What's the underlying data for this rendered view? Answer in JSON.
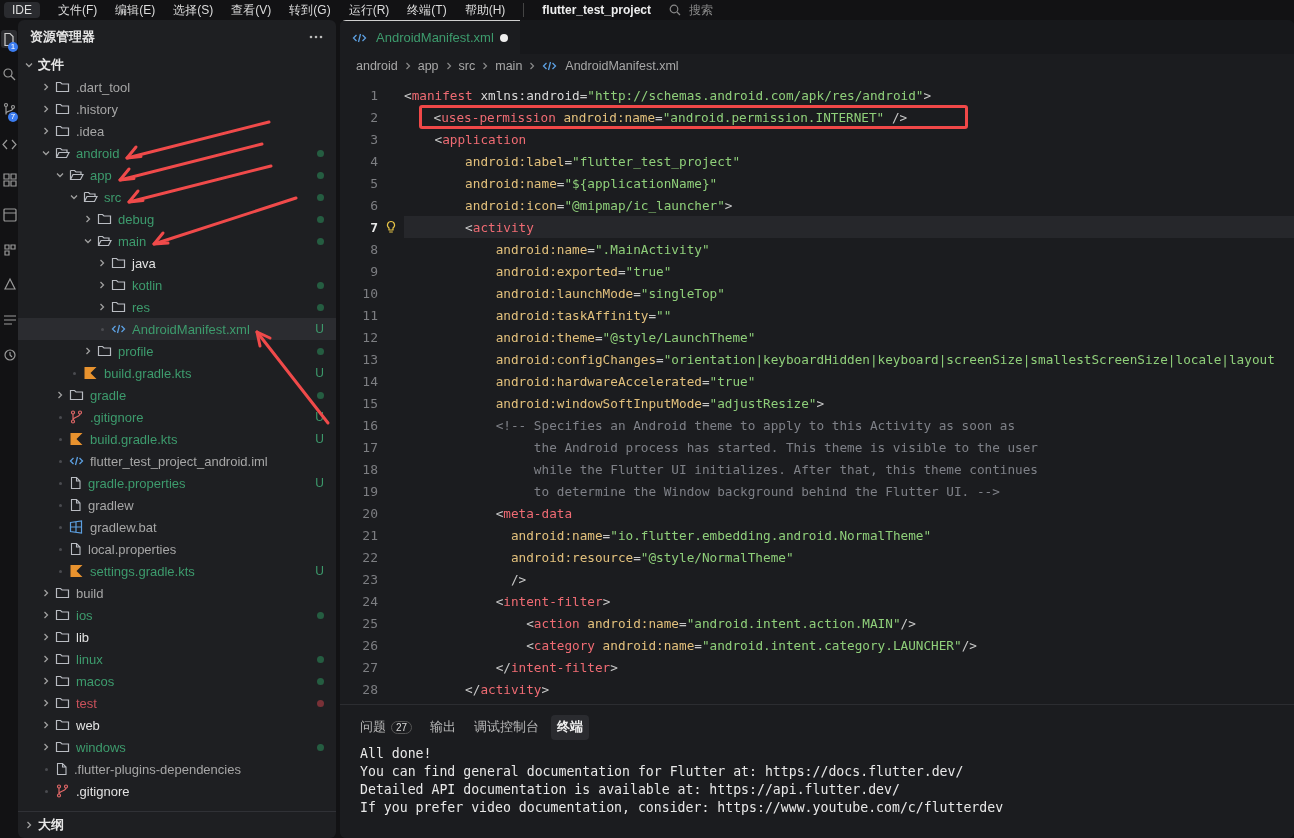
{
  "menu_bar": {
    "logo": "IDE",
    "menus": [
      "文件(F)",
      "编辑(E)",
      "选择(S)",
      "查看(V)",
      "转到(G)",
      "运行(R)",
      "终端(T)",
      "帮助(H)"
    ],
    "project_title": "flutter_test_project",
    "search": {
      "placeholder": "搜索"
    }
  },
  "activity_bar": [
    {
      "selected": true,
      "badge": "1"
    },
    {
      "selected": false
    },
    {
      "selected": false,
      "badge": "7"
    },
    {
      "selected": false
    },
    {
      "selected": false
    },
    {
      "selected": false
    },
    {
      "selected": false
    },
    {
      "selected": false
    },
    {
      "selected": false
    },
    {
      "selected": false
    }
  ],
  "sidebar": {
    "title": "资源管理器",
    "sections": [
      {
        "title": "文件",
        "expanded": true,
        "items": [
          {
            "label": ".dart_tool",
            "kind": "folder",
            "expanded": false,
            "selected": false,
            "color": "#a6a6a6",
            "dot": false
          },
          {
            "label": ".history",
            "kind": "folder",
            "expanded": false,
            "selected": false,
            "color": "#a6a6a6",
            "dot": false
          },
          {
            "label": ".idea",
            "kind": "folder",
            "expanded": false,
            "selected": false,
            "color": "#a6a6a6",
            "dot": false
          },
          {
            "label": "android",
            "kind": "folder",
            "expanded": true,
            "selected": false,
            "color": "#3d9b6d",
            "dot": true,
            "arrow": {
              "kind": "upper-right"
            },
            "children": [
              {
                "label": "app",
                "kind": "folder",
                "expanded": true,
                "selected": false,
                "color": "#3d9b6d",
                "dot": true,
                "arrow": {
                  "kind": "upper-right"
                },
                "children": [
                  {
                    "label": "src",
                    "kind": "folder",
                    "expanded": true,
                    "selected": false,
                    "color": "#3d9b6d",
                    "dot": true,
                    "arrow": {
                      "kind": "upper-right"
                    },
                    "children": [
                      {
                        "label": "debug",
                        "kind": "folder",
                        "expanded": false,
                        "selected": false,
                        "color": "#3d9b6d",
                        "dot": true
                      },
                      {
                        "label": "main",
                        "kind": "folder",
                        "expanded": true,
                        "selected": false,
                        "color": "#3d9b6d",
                        "dot": true,
                        "arrow": {
                          "kind": "upper-right-long"
                        },
                        "children": [
                          {
                            "label": "java",
                            "kind": "folder",
                            "expanded": false,
                            "selected": false,
                            "color": "#e2e2e2",
                            "dot": false
                          },
                          {
                            "label": "kotlin",
                            "kind": "folder",
                            "expanded": false,
                            "selected": false,
                            "color": "#3d9b6d",
                            "dot": true
                          },
                          {
                            "label": "res",
                            "kind": "folder",
                            "expanded": false,
                            "selected": false,
                            "color": "#3d9b6d",
                            "dot": true
                          },
                          {
                            "label": "AndroidManifest.xml",
                            "kind": "xml",
                            "selected": true,
                            "color": "#3d9b6d",
                            "dot": false,
                            "badge": "U",
                            "arrow": {
                              "kind": "lower-right"
                            }
                          }
                        ]
                      },
                      {
                        "label": "profile",
                        "kind": "folder",
                        "expanded": false,
                        "selected": false,
                        "color": "#3d9b6d",
                        "dot": true
                      }
                    ]
                  },
                  {
                    "label": "build.gradle.kts",
                    "kind": "kotlin",
                    "selected": false,
                    "color": "#3d9b6d",
                    "dot": false,
                    "badge": "U"
                  }
                ]
              },
              {
                "label": "gradle",
                "kind": "folder",
                "expanded": false,
                "selected": false,
                "color": "#3d9b6d",
                "dot": true
              },
              {
                "label": ".gitignore",
                "kind": "git",
                "selected": false,
                "color": "#3d9b6d",
                "dot": false,
                "badge": "U"
              },
              {
                "label": "build.gradle.kts",
                "kind": "kotlin",
                "selected": false,
                "color": "#3d9b6d",
                "dot": false,
                "badge": "U"
              },
              {
                "label": "flutter_test_project_android.iml",
                "kind": "xml",
                "selected": false,
                "color": "#a6a6a6",
                "dot": false
              },
              {
                "label": "gradle.properties",
                "kind": "file",
                "selected": false,
                "color": "#3d9b6d",
                "dot": false,
                "badge": "U"
              },
              {
                "label": "gradlew",
                "kind": "file",
                "selected": false,
                "color": "#a6a6a6",
                "dot": false
              },
              {
                "label": "gradlew.bat",
                "kind": "windows",
                "selected": false,
                "color": "#a6a6a6",
                "dot": false
              },
              {
                "label": "local.properties",
                "kind": "file",
                "selected": false,
                "color": "#a6a6a6",
                "dot": false
              },
              {
                "label": "settings.gradle.kts",
                "kind": "kotlin",
                "selected": false,
                "color": "#3d9b6d",
                "dot": false,
                "badge": "U"
              }
            ]
          },
          {
            "label": "build",
            "kind": "folder",
            "expanded": false,
            "selected": false,
            "color": "#a6a6a6",
            "dot": false
          },
          {
            "label": "ios",
            "kind": "folder",
            "expanded": false,
            "selected": false,
            "color": "#3d9b6d",
            "dot": true
          },
          {
            "label": "lib",
            "kind": "folder",
            "expanded": false,
            "selected": false,
            "color": "#e2e2e2",
            "dot": false
          },
          {
            "label": "linux",
            "kind": "folder",
            "expanded": false,
            "selected": false,
            "color": "#3d9b6d",
            "dot": true
          },
          {
            "label": "macos",
            "kind": "folder",
            "expanded": false,
            "selected": false,
            "color": "#3d9b6d",
            "dot": true
          },
          {
            "label": "test",
            "kind": "folder",
            "expanded": false,
            "selected": false,
            "color": "#c9515b",
            "dot": true
          },
          {
            "label": "web",
            "kind": "folder",
            "expanded": false,
            "selected": false,
            "color": "#e2e2e2",
            "dot": false
          },
          {
            "label": "windows",
            "kind": "folder",
            "expanded": false,
            "selected": false,
            "color": "#3d9b6d",
            "dot": true
          },
          {
            "label": ".flutter-plugins-dependencies",
            "kind": "file",
            "selected": false,
            "color": "#a6a6a6",
            "dot": false
          },
          {
            "label": ".gitignore",
            "kind": "git",
            "selected": false,
            "color": "#e2e2e2",
            "dot": false
          }
        ]
      },
      {
        "title": "大纲",
        "expanded": false
      }
    ]
  },
  "editor": {
    "tabs": [
      {
        "label": "AndroidManifest.xml",
        "selected": true,
        "dirty": true
      }
    ],
    "breadcrumb": [
      {
        "label": "android",
        "kind": "folder"
      },
      {
        "label": "app",
        "kind": "folder"
      },
      {
        "label": "src",
        "kind": "folder"
      },
      {
        "label": "main",
        "kind": "folder"
      },
      {
        "label": "AndroidManifest.xml",
        "kind": "xml"
      }
    ],
    "lines": [
      {
        "number": "1",
        "active": false,
        "boxed": false,
        "tokens": [
          {
            "kind": "punct",
            "text": "<"
          },
          {
            "kind": "tag",
            "text": "manifest"
          },
          {
            "kind": "plain",
            "text": " xmlns:android"
          },
          {
            "kind": "punct",
            "text": "="
          },
          {
            "kind": "string",
            "text": "\"http://schemas.android.com/apk/res/android\""
          },
          {
            "kind": "punct",
            "text": ">"
          }
        ]
      },
      {
        "number": "2",
        "active": false,
        "boxed": true,
        "tokens": [
          {
            "kind": "punct",
            "text": "    <"
          },
          {
            "kind": "tag",
            "text": "uses-permission"
          },
          {
            "kind": "attr",
            "text": " android:name"
          },
          {
            "kind": "punct",
            "text": "="
          },
          {
            "kind": "string",
            "text": "\"android.permission.INTERNET\""
          },
          {
            "kind": "punct",
            "text": " />"
          }
        ]
      },
      {
        "number": "3",
        "active": false,
        "boxed": false,
        "tokens": [
          {
            "kind": "punct",
            "text": "    <"
          },
          {
            "kind": "tag",
            "text": "application"
          }
        ]
      },
      {
        "number": "4",
        "active": false,
        "boxed": false,
        "tokens": [
          {
            "kind": "attr",
            "text": "        android:label"
          },
          {
            "kind": "punct",
            "text": "="
          },
          {
            "kind": "string",
            "text": "\"flutter_test_project\""
          }
        ]
      },
      {
        "number": "5",
        "active": false,
        "boxed": false,
        "tokens": [
          {
            "kind": "attr",
            "text": "        android:name"
          },
          {
            "kind": "punct",
            "text": "="
          },
          {
            "kind": "string",
            "text": "\"${applicationName}\""
          }
        ]
      },
      {
        "number": "6",
        "active": false,
        "boxed": false,
        "tokens": [
          {
            "kind": "attr",
            "text": "        android:icon"
          },
          {
            "kind": "punct",
            "text": "="
          },
          {
            "kind": "string",
            "text": "\"@mipmap/ic_launcher\""
          },
          {
            "kind": "punct",
            "text": ">"
          }
        ]
      },
      {
        "number": "7",
        "active": true,
        "boxed": false,
        "tokens": [
          {
            "kind": "punct",
            "text": "        <"
          },
          {
            "kind": "tag",
            "text": "activity"
          }
        ]
      },
      {
        "number": "8",
        "active": false,
        "boxed": false,
        "tokens": [
          {
            "kind": "attr",
            "text": "            android:name"
          },
          {
            "kind": "punct",
            "text": "="
          },
          {
            "kind": "string",
            "text": "\".MainActivity\""
          }
        ]
      },
      {
        "number": "9",
        "active": false,
        "boxed": false,
        "tokens": [
          {
            "kind": "attr",
            "text": "            android:exported"
          },
          {
            "kind": "punct",
            "text": "="
          },
          {
            "kind": "string",
            "text": "\"true\""
          }
        ]
      },
      {
        "number": "10",
        "active": false,
        "boxed": false,
        "tokens": [
          {
            "kind": "attr",
            "text": "            android:launchMode"
          },
          {
            "kind": "punct",
            "text": "="
          },
          {
            "kind": "string",
            "text": "\"singleTop\""
          }
        ]
      },
      {
        "number": "11",
        "active": false,
        "boxed": false,
        "tokens": [
          {
            "kind": "attr",
            "text": "            android:taskAffinity"
          },
          {
            "kind": "punct",
            "text": "="
          },
          {
            "kind": "string",
            "text": "\"\""
          }
        ]
      },
      {
        "number": "12",
        "active": false,
        "boxed": false,
        "tokens": [
          {
            "kind": "attr",
            "text": "            android:theme"
          },
          {
            "kind": "punct",
            "text": "="
          },
          {
            "kind": "string",
            "text": "\"@style/LaunchTheme\""
          }
        ]
      },
      {
        "number": "13",
        "active": false,
        "boxed": false,
        "tokens": [
          {
            "kind": "attr",
            "text": "            android:configChanges"
          },
          {
            "kind": "punct",
            "text": "="
          },
          {
            "kind": "string",
            "text": "\"orientation|keyboardHidden|keyboard|screenSize|smallestScreenSize|locale|layout"
          }
        ]
      },
      {
        "number": "14",
        "active": false,
        "boxed": false,
        "tokens": [
          {
            "kind": "attr",
            "text": "            android:hardwareAccelerated"
          },
          {
            "kind": "punct",
            "text": "="
          },
          {
            "kind": "string",
            "text": "\"true\""
          }
        ]
      },
      {
        "number": "15",
        "active": false,
        "boxed": false,
        "tokens": [
          {
            "kind": "attr",
            "text": "            android:windowSoftInputMode"
          },
          {
            "kind": "punct",
            "text": "="
          },
          {
            "kind": "string",
            "text": "\"adjustResize\""
          },
          {
            "kind": "punct",
            "text": ">"
          }
        ]
      },
      {
        "number": "16",
        "active": false,
        "boxed": false,
        "tokens": [
          {
            "kind": "comment",
            "text": "            <!-- Specifies an Android theme to apply to this Activity as soon as"
          }
        ]
      },
      {
        "number": "17",
        "active": false,
        "boxed": false,
        "tokens": [
          {
            "kind": "comment",
            "text": "                 the Android process has started. This theme is visible to the user"
          }
        ]
      },
      {
        "number": "18",
        "active": false,
        "boxed": false,
        "tokens": [
          {
            "kind": "comment",
            "text": "                 while the Flutter UI initializes. After that, this theme continues"
          }
        ]
      },
      {
        "number": "19",
        "active": false,
        "boxed": false,
        "tokens": [
          {
            "kind": "comment",
            "text": "                 to determine the Window background behind the Flutter UI. -->"
          }
        ]
      },
      {
        "number": "20",
        "active": false,
        "boxed": false,
        "tokens": [
          {
            "kind": "punct",
            "text": "            <"
          },
          {
            "kind": "tag",
            "text": "meta-data"
          }
        ]
      },
      {
        "number": "21",
        "active": false,
        "boxed": false,
        "tokens": [
          {
            "kind": "attr",
            "text": "              android:name"
          },
          {
            "kind": "punct",
            "text": "="
          },
          {
            "kind": "string",
            "text": "\"io.flutter.embedding.android.NormalTheme\""
          }
        ]
      },
      {
        "number": "22",
        "active": false,
        "boxed": false,
        "tokens": [
          {
            "kind": "attr",
            "text": "              android:resource"
          },
          {
            "kind": "punct",
            "text": "="
          },
          {
            "kind": "string",
            "text": "\"@style/NormalTheme\""
          }
        ]
      },
      {
        "number": "23",
        "active": false,
        "boxed": false,
        "tokens": [
          {
            "kind": "punct",
            "text": "              />"
          }
        ]
      },
      {
        "number": "24",
        "active": false,
        "boxed": false,
        "tokens": [
          {
            "kind": "punct",
            "text": "            <"
          },
          {
            "kind": "tag",
            "text": "intent-filter"
          },
          {
            "kind": "punct",
            "text": ">"
          }
        ]
      },
      {
        "number": "25",
        "active": false,
        "boxed": false,
        "tokens": [
          {
            "kind": "punct",
            "text": "                <"
          },
          {
            "kind": "tag",
            "text": "action"
          },
          {
            "kind": "attr",
            "text": " android:name"
          },
          {
            "kind": "punct",
            "text": "="
          },
          {
            "kind": "string",
            "text": "\"android.intent.action.MAIN\""
          },
          {
            "kind": "punct",
            "text": "/>"
          }
        ]
      },
      {
        "number": "26",
        "active": false,
        "boxed": false,
        "tokens": [
          {
            "kind": "punct",
            "text": "                <"
          },
          {
            "kind": "tag",
            "text": "category"
          },
          {
            "kind": "attr",
            "text": " android:name"
          },
          {
            "kind": "punct",
            "text": "="
          },
          {
            "kind": "string",
            "text": "\"android.intent.category.LAUNCHER\""
          },
          {
            "kind": "punct",
            "text": "/>"
          }
        ]
      },
      {
        "number": "27",
        "active": false,
        "boxed": false,
        "tokens": [
          {
            "kind": "punct",
            "text": "            </"
          },
          {
            "kind": "tag",
            "text": "intent-filter"
          },
          {
            "kind": "punct",
            "text": ">"
          }
        ]
      },
      {
        "number": "28",
        "active": false,
        "boxed": false,
        "tokens": [
          {
            "kind": "punct",
            "text": "        </"
          },
          {
            "kind": "tag",
            "text": "activity"
          },
          {
            "kind": "punct",
            "text": ">"
          }
        ]
      }
    ]
  },
  "panel": {
    "tabs": [
      {
        "label": "问题",
        "badge": "27",
        "selected": false
      },
      {
        "label": "输出",
        "selected": false
      },
      {
        "label": "调试控制台",
        "selected": false
      },
      {
        "label": "终端",
        "selected": true
      }
    ],
    "terminal": [
      "All done!",
      "You can find general documentation for Flutter at: https://docs.flutter.dev/",
      "Detailed API documentation is available at: https://api.flutter.dev/",
      "If you prefer video documentation, consider: https://www.youtube.com/c/flutterdev"
    ]
  }
}
